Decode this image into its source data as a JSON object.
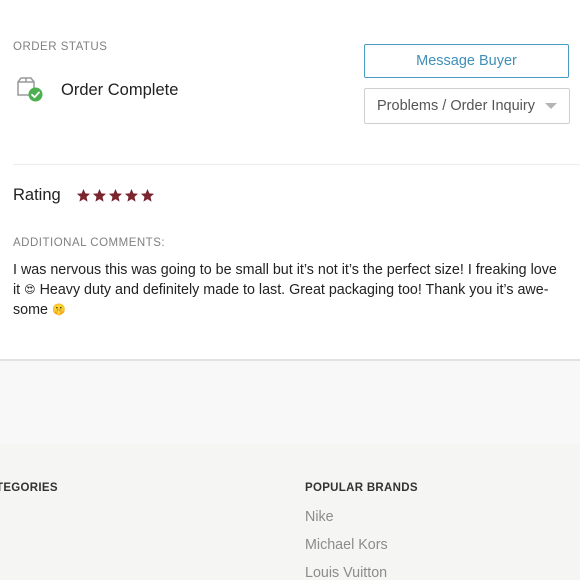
{
  "order_status": {
    "section_label": "ORDER STATUS",
    "status_text": "Order Complete",
    "status_icon": "box-check-icon",
    "status_color": "#4caf50"
  },
  "actions": {
    "message_buyer_label": "Message Buyer",
    "problems_select_value": "Problems / Order Inquiry",
    "accent_color": "#3f8fb8"
  },
  "rating": {
    "label": "Rating",
    "stars": 5,
    "max_stars": 5,
    "star_color": "#7a2530"
  },
  "comments": {
    "label": "ADDITIONAL COMMENTS:",
    "line1": "I was nervous this was going to be small but it’s not it’s the perfect size! I freaking love",
    "line2_pre": "it ",
    "emoji1": "😍",
    "line2_post": " Heavy duty and definitely made to last. Great packaging too! Thank you it’s awe-",
    "line3_pre": "some ",
    "emoji2": "🤫"
  },
  "footer": {
    "categories_title": "TEGORIES",
    "brands_title": "POPULAR BRANDS",
    "brands": [
      "Nike",
      "Michael Kors",
      "Louis Vuitton"
    ]
  }
}
